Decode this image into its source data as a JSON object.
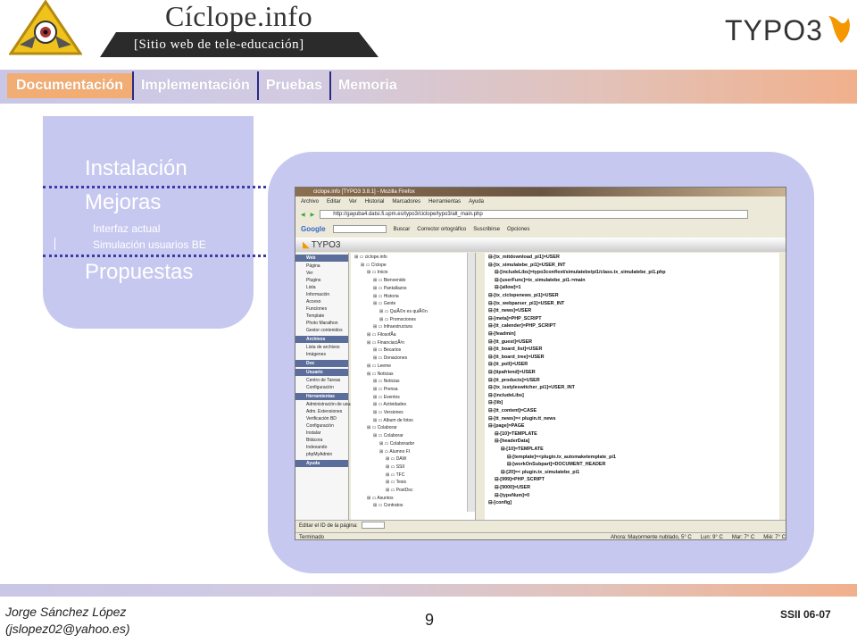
{
  "header": {
    "site_title": "Cíclope.info",
    "site_subtitle": "[Sitio web de tele-educación]",
    "brand_logo": "TYPO3"
  },
  "nav": {
    "tabs": [
      {
        "label": "Documentación",
        "active": true
      },
      {
        "label": "Implementación",
        "active": false
      },
      {
        "label": "Pruebas",
        "active": false
      },
      {
        "label": "Memoria",
        "active": false
      }
    ]
  },
  "side_menu": {
    "items": [
      {
        "label": "Instalación"
      },
      {
        "label": "Mejoras"
      },
      {
        "label": "Interfaz actual"
      },
      {
        "label": "Simulación usuarios BE"
      },
      {
        "label": "Propuestas"
      }
    ]
  },
  "screenshot": {
    "window_title": "ciclope.info [TYPO3 3.8.1] - Mozilla Firefox",
    "menu": [
      "Archivo",
      "Editar",
      "Ver",
      "Historial",
      "Marcadores",
      "Herramientas",
      "Ayuda"
    ],
    "url": "http://gayuba4.datsi.fi.upm.es/typo3/ciclope/typo3/alt_main.php",
    "google_label": "Google",
    "search_btn": "Buscar",
    "spell_btn": "Corrector ortográfico",
    "subscribe_btn": "Suscribirse",
    "options_btn": "Opciones",
    "typo3_label": "TYPO3",
    "modules": [
      {
        "section": "Web",
        "items": [
          "Página",
          "Ver",
          "Plugins",
          "Lista",
          "Información",
          "Acceso",
          "Funciones",
          "Template",
          "Photo Marathon",
          "Gestor contenidos"
        ]
      },
      {
        "section": "Archivos",
        "items": [
          "Lista de archivos",
          "Imágenes"
        ]
      },
      {
        "section": "Doc",
        "items": []
      },
      {
        "section": "Usuario",
        "items": [
          "Centro de Tareas",
          "Configuración"
        ]
      },
      {
        "section": "Herramientas",
        "items": [
          "Administración de usuarios",
          "Adm. Extensiones",
          "Verificación BD",
          "Configuración",
          "Instalar",
          "Bitácora",
          "Indexando",
          "phpMyAdmin"
        ]
      },
      {
        "section": "Ayuda",
        "items": []
      }
    ],
    "tree": [
      "ciclope.info",
      "Cíclope",
      "Inicio",
      "Bienvenido",
      "Pantallazos",
      "Historia",
      "Gente",
      "QuiÃ©n es quiÃ©n",
      "Promociones",
      "Infraestructura",
      "FilosofÃ­a",
      "FinanciaciÃ³n",
      "Becarios",
      "Donaciones",
      "Leeme",
      "Noticias",
      "Noticias",
      "Prensa",
      "Eventos",
      "Actividades",
      "Versiones",
      "Album de fotos",
      "Colaborar",
      "Colaborar",
      "Colaborador",
      "Alumno FI",
      "DAW",
      "SSII",
      "TFC",
      "Tesis",
      "PostDoc",
      "Asuntos",
      "Contratos"
    ],
    "code": [
      "[tx_mitdownload_pi1]=USER",
      "[tx_simulatebe_pi1]=USER_INT",
      "[includeLibs]=typo3conf/ext/simulatebe/pi1/class.tx_simulatebe_pi1.php",
      "[userFunc]=tx_simulatebe_pi1->main",
      "[allow]=1",
      "[tx_ciclopenews_pi1]=USER",
      "[tx_webparser_pi1]=USER_INT",
      "[tt_news]=USER",
      "[meta]=PHP_SCRIPT",
      "[tt_calender]=PHP_SCRIPT",
      "[feadmin]",
      "[tt_guest]=USER",
      "[tt_board_list]=USER",
      "[tt_board_tree]=USER",
      "[tt_poll]=USER",
      "[tipafriend]=USER",
      "[tt_products]=USER",
      "[tx_isstyleswitcher_pi1]=USER_INT",
      "[includeLibs]",
      "[lib]",
      "[tt_content]=CASE",
      "[tt_news]=< plugin.tt_news",
      "[page]=PAGE",
      "[10]=TEMPLATE",
      "[headerData]",
      "[10]=TEMPLATE",
      "[template]=<plugin.tx_automaketemplate_pi1",
      "[workOnSubpart]=DOCUMENT_HEADER",
      "[20]=< plugin.tx_simulatebe_pi1",
      "[999]=PHP_SCRIPT",
      "[9000]=USER",
      "[typeNum]=0",
      "[config]"
    ],
    "page_id_label": "Editar el ID de la página:",
    "status_done": "Terminado",
    "weather_now": "Ahora: Mayormente nublado, 5° C",
    "weather_mon": "Lun: 9° C",
    "weather_tue": "Mar: 7° C",
    "weather_wed": "Mié: 7° C"
  },
  "footer": {
    "author_name": "Jorge Sánchez López",
    "author_email": "(jslopez02@yahoo.es)",
    "page_number": "9",
    "course": "SSII 06-07"
  }
}
